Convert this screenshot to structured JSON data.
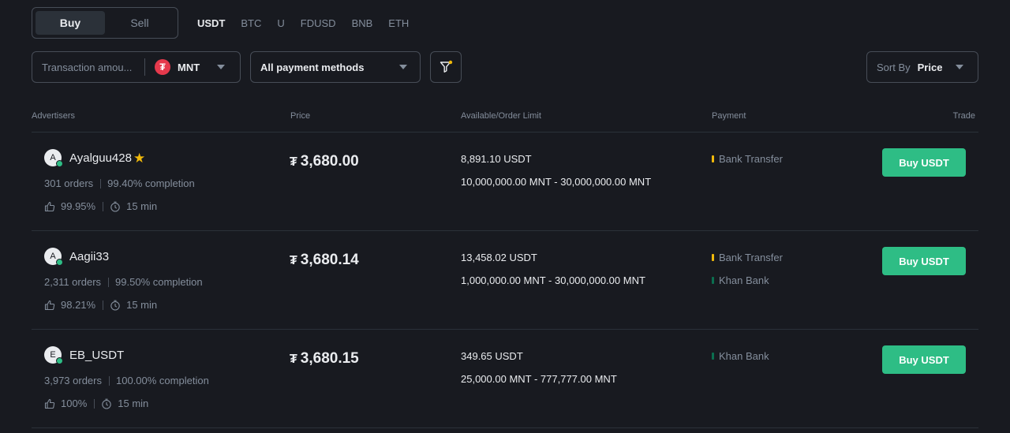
{
  "side_toggle": {
    "buy": "Buy",
    "sell": "Sell"
  },
  "crypto_tabs": [
    "USDT",
    "BTC",
    "U",
    "FDUSD",
    "BNB",
    "ETH"
  ],
  "filters": {
    "amount_placeholder": "Transaction amou...",
    "fiat_symbol": "₮",
    "fiat_code": "MNT",
    "payment_methods": "All payment methods",
    "sort_prefix": "Sort By",
    "sort_value": "Price"
  },
  "table_headers": {
    "advertisers": "Advertisers",
    "price": "Price",
    "limit": "Available/Order Limit",
    "payment": "Payment",
    "trade": "Trade"
  },
  "colors": {
    "accent_green": "#2ebd85",
    "bank_transfer": "#f0b90b",
    "khan_bank": "#0b6e4f",
    "background": "#181a20"
  },
  "ads": [
    {
      "initial": "A",
      "name": "Ayalguu428",
      "verified_badge": "star-icon",
      "orders": "301 orders",
      "completion": "99.40% completion",
      "positive": "99.95%",
      "time": "15 min",
      "currency_symbol": "₮",
      "price": "3,680.00",
      "available": "8,891.10 USDT",
      "limit": "10,000,000.00 MNT - 30,000,000.00 MNT",
      "payments": [
        {
          "label": "Bank Transfer",
          "color": "#f0b90b"
        }
      ],
      "button": "Buy USDT"
    },
    {
      "initial": "A",
      "name": "Aagii33",
      "orders": "2,311 orders",
      "completion": "99.50% completion",
      "positive": "98.21%",
      "time": "15 min",
      "currency_symbol": "₮",
      "price": "3,680.14",
      "available": "13,458.02 USDT",
      "limit": "1,000,000.00 MNT - 30,000,000.00 MNT",
      "payments": [
        {
          "label": "Bank Transfer",
          "color": "#f0b90b"
        },
        {
          "label": "Khan Bank",
          "color": "#0b6e4f"
        }
      ],
      "button": "Buy USDT"
    },
    {
      "initial": "E",
      "name": "EB_USDT",
      "orders": "3,973 orders",
      "completion": "100.00% completion",
      "positive": "100%",
      "time": "15 min",
      "currency_symbol": "₮",
      "price": "3,680.15",
      "available": "349.65 USDT",
      "limit": "25,000.00 MNT - 777,777.00 MNT",
      "payments": [
        {
          "label": "Khan Bank",
          "color": "#0b6e4f"
        }
      ],
      "button": "Buy USDT"
    }
  ]
}
